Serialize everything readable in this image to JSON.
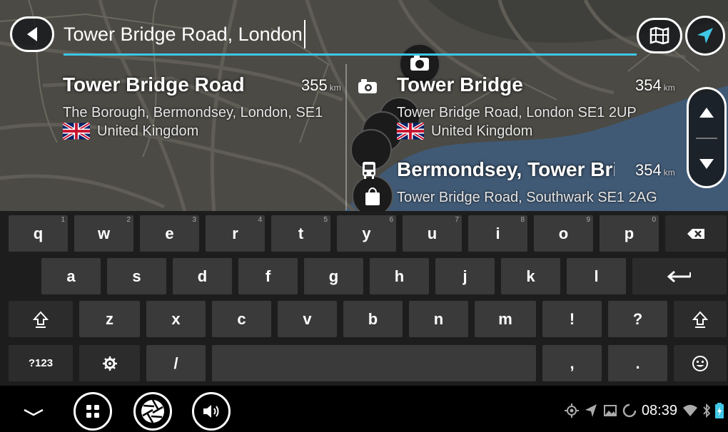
{
  "search": {
    "query": "Tower Bridge Road, London"
  },
  "results": [
    {
      "title": "Tower Bridge Road",
      "distance": "355",
      "unit": "km",
      "address": "The Borough, Bermondsey, London, SE1",
      "country": "United Kingdom",
      "icon": "street"
    },
    {
      "title": "Tower Bridge",
      "distance": "354",
      "unit": "km",
      "address": "Tower Bridge Road, London SE1 2UP",
      "country": "United Kingdom",
      "icon": "camera-icon"
    },
    {
      "title": "Bermondsey, Tower Bridge",
      "distance": "354",
      "unit": "km",
      "address": "Tower Bridge Road, Southwark SE1 2AG",
      "icon": "bus-icon"
    }
  ],
  "keyboard": {
    "row1": [
      {
        "label": "q",
        "hint": "1"
      },
      {
        "label": "w",
        "hint": "2"
      },
      {
        "label": "e",
        "hint": "3"
      },
      {
        "label": "r",
        "hint": "4"
      },
      {
        "label": "t",
        "hint": "5"
      },
      {
        "label": "y",
        "hint": "6"
      },
      {
        "label": "u",
        "hint": "7"
      },
      {
        "label": "i",
        "hint": "8"
      },
      {
        "label": "o",
        "hint": "9"
      },
      {
        "label": "p",
        "hint": "0"
      }
    ],
    "row2": [
      "a",
      "s",
      "d",
      "f",
      "g",
      "h",
      "j",
      "k",
      "l"
    ],
    "row3": [
      "z",
      "x",
      "c",
      "v",
      "b",
      "n",
      "m",
      "!",
      "?"
    ],
    "symbols_label": "?123",
    "slash": "/",
    "comma": ",",
    "period": "."
  },
  "status": {
    "time": "08:39"
  },
  "colors": {
    "accent": "#3fc7e6",
    "key": "#3a3a3b",
    "keyboard_bg": "#1d1d1e"
  }
}
